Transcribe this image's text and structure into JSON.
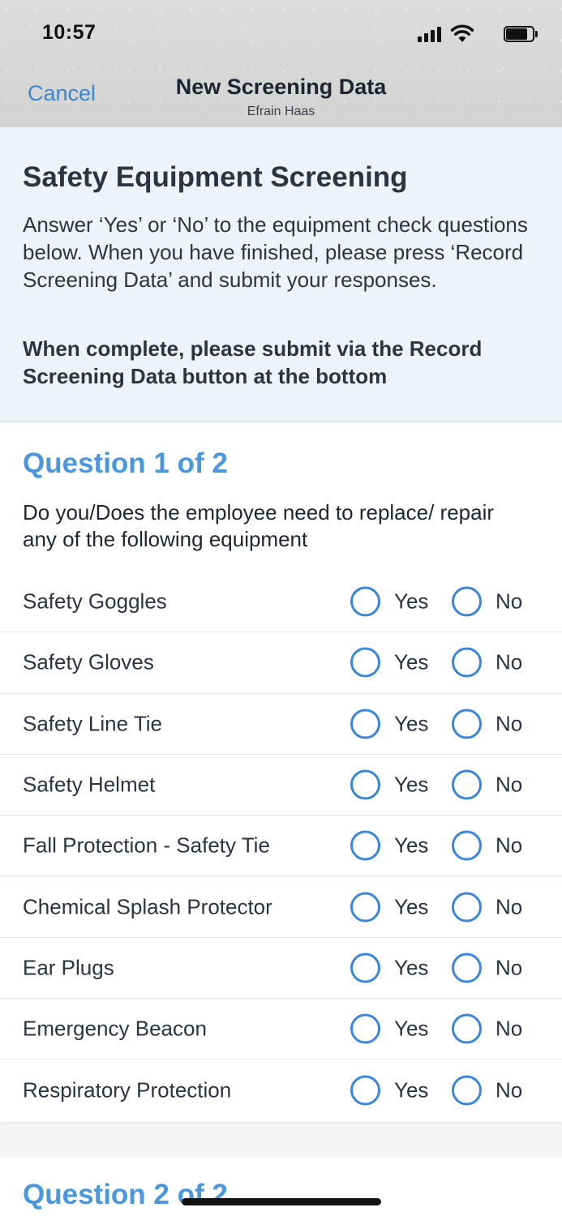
{
  "status_bar": {
    "time": "10:57"
  },
  "nav": {
    "cancel_label": "Cancel",
    "title": "New Screening Data",
    "subtitle": "Efrain Haas"
  },
  "intro": {
    "title": "Safety Equipment Screening",
    "text": "Answer ‘Yes’ or ‘No’ to the equipment check questions below.  When you have finished, please press ‘Record Screening Data’ and submit your responses.",
    "bold_text": "When complete, please submit via the Record Screening Data button at the bottom"
  },
  "question1": {
    "heading": "Question 1 of 2",
    "text": "Do you/Does the employee need to replace/ repair any of the following equipment",
    "yes_label": "Yes",
    "no_label": "No",
    "items": [
      {
        "label": "Safety Goggles"
      },
      {
        "label": "Safety Gloves"
      },
      {
        "label": "Safety Line Tie"
      },
      {
        "label": "Safety Helmet"
      },
      {
        "label": "Fall Protection - Safety Tie"
      },
      {
        "label": "Chemical Splash Protector"
      },
      {
        "label": "Ear Plugs"
      },
      {
        "label": "Emergency Beacon"
      },
      {
        "label": "Respiratory Protection"
      }
    ]
  },
  "question2": {
    "heading": "Question 2 of 2"
  },
  "colors": {
    "accent": "#3a86d8",
    "heading_blue": "#4a97dc",
    "intro_bg": "#eff3f9"
  }
}
